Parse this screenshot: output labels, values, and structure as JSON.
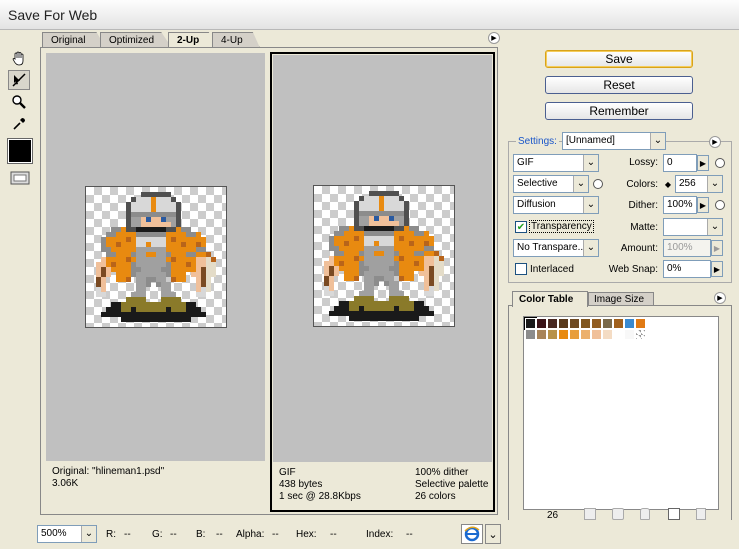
{
  "window": {
    "title": "Save For Web"
  },
  "tabs": [
    "Original",
    "Optimized",
    "2-Up",
    "4-Up"
  ],
  "active_tab": "2-Up",
  "left_pane": {
    "line1": "Original: \"hlineman1.psd\"",
    "line2": "3.06K"
  },
  "right_pane": {
    "col1": [
      "GIF",
      "438 bytes",
      "1 sec @ 28.8Kbps"
    ],
    "col2": [
      "100% dither",
      "Selective palette",
      "26 colors"
    ]
  },
  "buttons": {
    "save": "Save",
    "reset": "Reset",
    "remember": "Remember"
  },
  "settings": {
    "label": "Settings:",
    "preset": "[Unnamed]",
    "format": "GIF",
    "lossy_label": "Lossy:",
    "lossy": "0",
    "palette": "Selective",
    "colors_label": "Colors:",
    "colors": "256",
    "dither_algo": "Diffusion",
    "dither_label": "Dither:",
    "dither": "100%",
    "transparency_label": "Transparency",
    "transparency_checked": true,
    "matte_label": "Matte:",
    "matte": "",
    "trans_dither": "No Transpare...",
    "amount_label": "Amount:",
    "amount": "100%",
    "interlaced_label": "Interlaced",
    "interlaced_checked": false,
    "websnap_label": "Web Snap:",
    "websnap": "0%"
  },
  "color_panel": {
    "tabs": [
      "Color Table",
      "Image Size"
    ],
    "count": "26",
    "colors": [
      "#1a1a1a",
      "#3b1418",
      "#4a2a22",
      "#5a3a1c",
      "#6e4a22",
      "#80561e",
      "#925e22",
      "#7a6a4a",
      "#a0601c",
      "#3a8ad0",
      "#e07a14",
      "#8c8c8c",
      "#a88458",
      "#b89248",
      "#e88a10",
      "#e89e3c",
      "#ecb06c",
      "#f0c09a",
      "#f4dcc4",
      "#ffffff",
      "#f8f8f8",
      "#ffffff"
    ]
  },
  "status": {
    "zoom": "500%",
    "r_label": "R:",
    "r": "--",
    "g_label": "G:",
    "g": "--",
    "b_label": "B:",
    "b": "--",
    "alpha_label": "Alpha:",
    "alpha": "--",
    "hex_label": "Hex:",
    "hex": "--",
    "index_label": "Index:",
    "index": "--"
  },
  "colors": {
    "accent": "#1a56c9",
    "window_bg": "#ece9d8",
    "pane_bg": "#c0c0c0"
  }
}
